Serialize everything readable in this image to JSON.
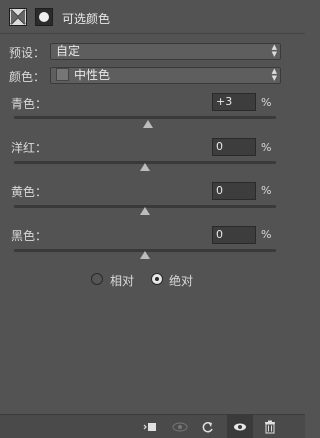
{
  "panel": {
    "title": "可选颜色",
    "header_icons": [
      "selective-color-adjustment-icon",
      "layer-mask-icon"
    ]
  },
  "preset": {
    "label": "预设：",
    "value": "自定"
  },
  "colors": {
    "label": "颜色：",
    "value": "中性色",
    "swatch_color": "#767676"
  },
  "sliders": [
    {
      "label": "青色：",
      "value": "+3",
      "unit": "%",
      "position": 3
    },
    {
      "label": "洋红：",
      "value": "0",
      "unit": "%",
      "position": 0
    },
    {
      "label": "黄色：",
      "value": "0",
      "unit": "%",
      "position": 0
    },
    {
      "label": "黑色：",
      "value": "0",
      "unit": "%",
      "position": 0
    }
  ],
  "method": {
    "options": [
      "相对",
      "绝对"
    ],
    "selected": "绝对"
  },
  "footer_icons": [
    "clip-to-layer-icon",
    "view-previous-state-icon",
    "reset-icon",
    "visibility-eye-icon",
    "delete-trash-icon"
  ]
}
